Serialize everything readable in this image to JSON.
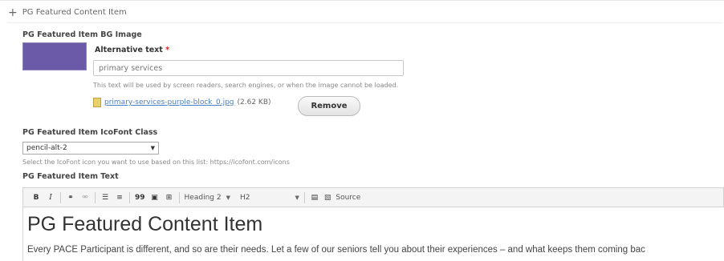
{
  "item_header": {
    "title": "PG Featured Content Item",
    "drag_glyph": "+"
  },
  "bg_image": {
    "label": "PG Featured Item BG Image",
    "alt_label": "Alternative text",
    "required_mark": "*",
    "alt_value": "primary services",
    "alt_description": "This text will be used by screen readers, search engines, or when the image cannot be loaded.",
    "file_name": "primary-services-purple-block_0.jpg",
    "file_size": "(2.62 KB)",
    "remove_label": "Remove",
    "thumbnail_color": "#6a5aa8"
  },
  "icofont": {
    "label": "PG Featured Item IcoFont Class",
    "selected": "pencil-alt-2",
    "description": "Select the IcoFont icon you want to use based on this list: https://icofont.com/icons"
  },
  "text_field": {
    "label": "PG Featured Item Text",
    "toolbar": {
      "bold": "B",
      "italic": "I",
      "quote": "99",
      "format": "Heading 2",
      "style": "H2",
      "source": "Source"
    },
    "heading": "PG Featured Content Item",
    "paragraph": "Every PACE Participant is different, and so are their needs. Let a few of our seniors tell you about their experiences – and what keeps them coming bac"
  }
}
